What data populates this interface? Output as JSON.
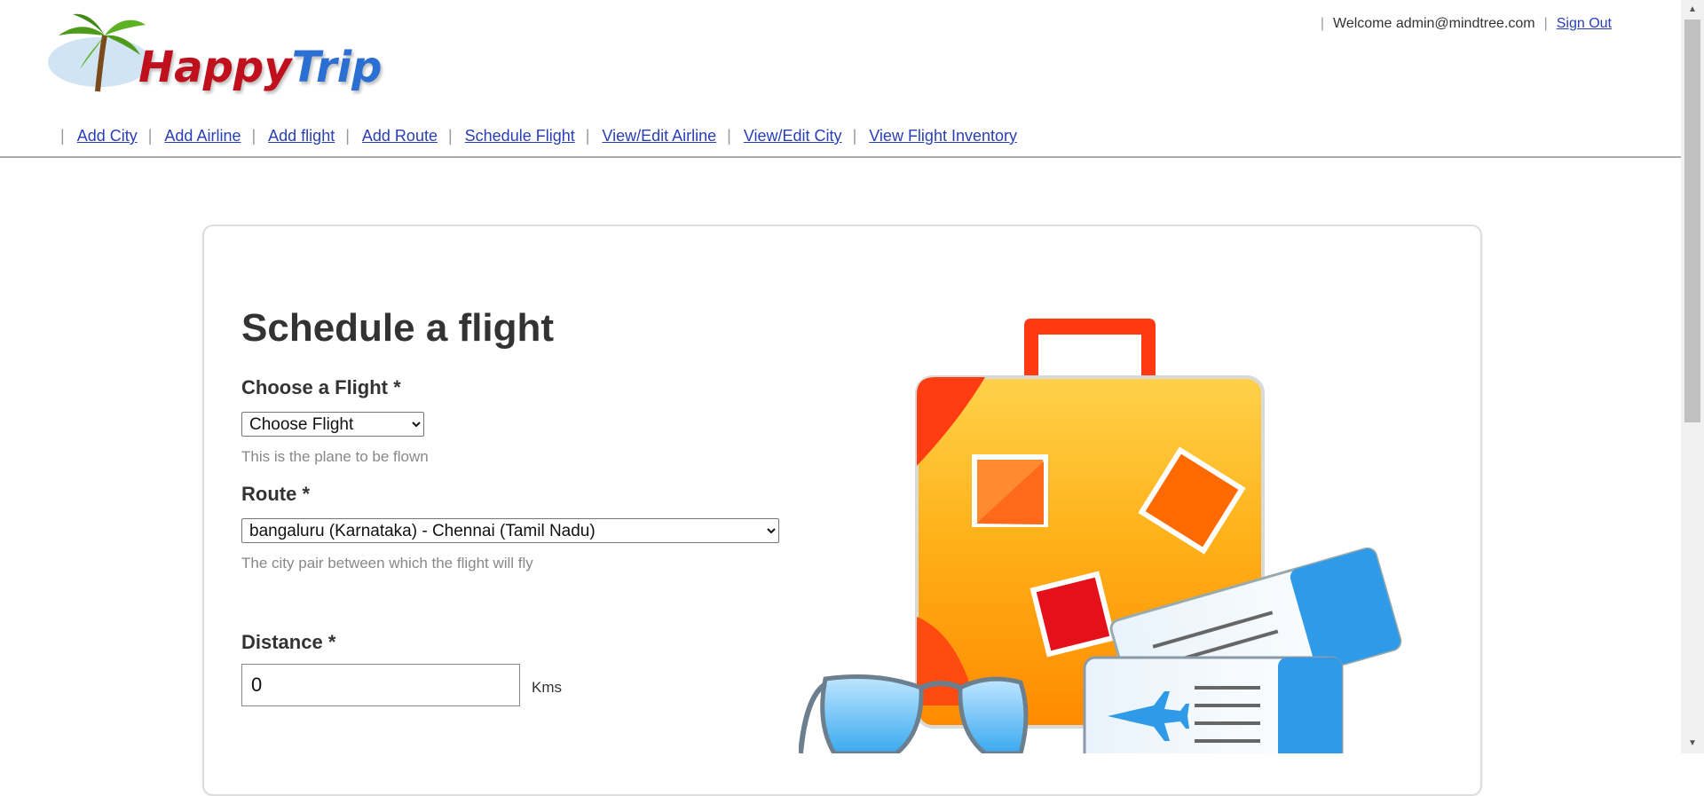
{
  "header": {
    "logo": {
      "word1": "Happy",
      "word2": "Trip"
    },
    "welcome_text": "Welcome admin@mindtree.com",
    "sign_out_label": "Sign Out"
  },
  "nav": {
    "items": [
      {
        "label": "Add City"
      },
      {
        "label": "Add Airline"
      },
      {
        "label": "Add flight"
      },
      {
        "label": "Add Route"
      },
      {
        "label": "Schedule Flight"
      },
      {
        "label": "View/Edit Airline"
      },
      {
        "label": "View/Edit City"
      },
      {
        "label": "View Flight Inventory"
      }
    ]
  },
  "form": {
    "title": "Schedule a flight",
    "flight": {
      "label": "Choose a Flight *",
      "selected": "Choose Flight",
      "help": "This is the plane to be flown"
    },
    "route": {
      "label": "Route *",
      "selected": "bangaluru (Karnataka) - Chennai (Tamil Nadu)",
      "help": "The city pair between which the flight will fly"
    },
    "distance": {
      "label": "Distance *",
      "value": "0",
      "unit": "Kms"
    }
  },
  "colors": {
    "link": "#2a3fb5",
    "logo_red": "#c0101e",
    "logo_blue": "#2a6fd1",
    "suitcase_orange": "#ff9a00",
    "ticket_blue": "#2f9be8"
  },
  "icons": {
    "logo": "palm-tree-icon",
    "illustration": "travel-suitcase-illustration",
    "scroll_up": "arrow-up-icon",
    "scroll_down": "arrow-down-icon"
  }
}
